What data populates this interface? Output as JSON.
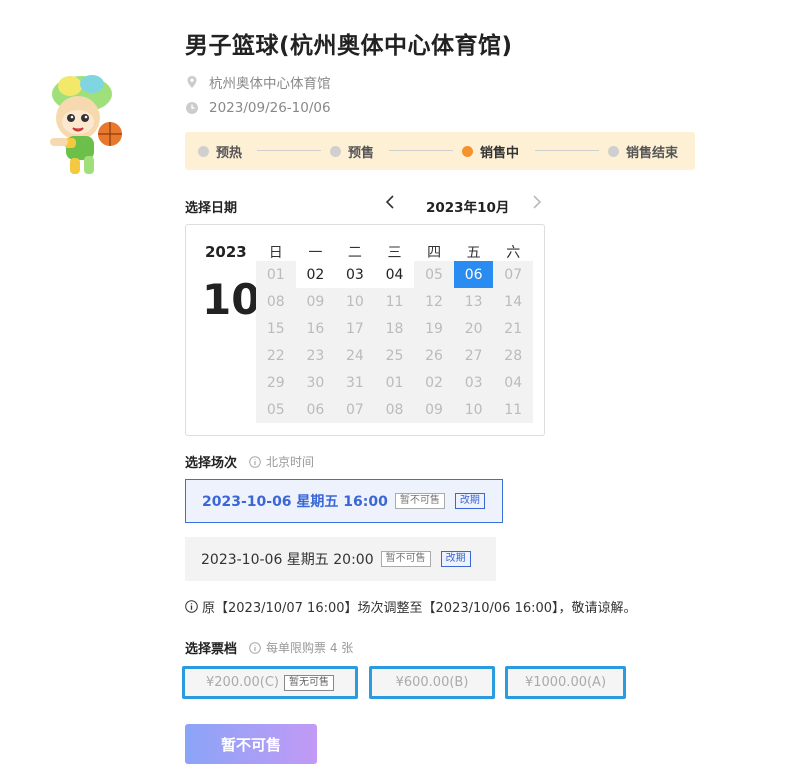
{
  "title": "男子篮球(杭州奥体中心体育馆)",
  "venue": "杭州奥体中心体育馆",
  "date_range": "2023/09/26-10/06",
  "progress": {
    "steps": [
      "预热",
      "预售",
      "销售中",
      "销售结束"
    ],
    "active_index": 2,
    "accent": "#f5922b"
  },
  "calendar_section": {
    "label": "选择日期",
    "month_label": "2023年10月",
    "year": "2023",
    "month": "10",
    "weekdays": [
      "日",
      "一",
      "二",
      "三",
      "四",
      "五",
      "六"
    ],
    "days": [
      {
        "d": "01",
        "state": "off"
      },
      {
        "d": "02",
        "state": "avail"
      },
      {
        "d": "03",
        "state": "avail"
      },
      {
        "d": "04",
        "state": "avail"
      },
      {
        "d": "05",
        "state": "off"
      },
      {
        "d": "06",
        "state": "selected"
      },
      {
        "d": "07",
        "state": "off"
      },
      {
        "d": "08",
        "state": "off"
      },
      {
        "d": "09",
        "state": "off"
      },
      {
        "d": "10",
        "state": "off"
      },
      {
        "d": "11",
        "state": "off"
      },
      {
        "d": "12",
        "state": "off"
      },
      {
        "d": "13",
        "state": "off"
      },
      {
        "d": "14",
        "state": "off"
      },
      {
        "d": "15",
        "state": "off"
      },
      {
        "d": "16",
        "state": "off"
      },
      {
        "d": "17",
        "state": "off"
      },
      {
        "d": "18",
        "state": "off"
      },
      {
        "d": "19",
        "state": "off"
      },
      {
        "d": "20",
        "state": "off"
      },
      {
        "d": "21",
        "state": "off"
      },
      {
        "d": "22",
        "state": "off"
      },
      {
        "d": "23",
        "state": "off"
      },
      {
        "d": "24",
        "state": "off"
      },
      {
        "d": "25",
        "state": "off"
      },
      {
        "d": "26",
        "state": "off"
      },
      {
        "d": "27",
        "state": "off"
      },
      {
        "d": "28",
        "state": "off"
      },
      {
        "d": "29",
        "state": "off"
      },
      {
        "d": "30",
        "state": "off"
      },
      {
        "d": "31",
        "state": "off"
      },
      {
        "d": "01",
        "state": "off"
      },
      {
        "d": "02",
        "state": "off"
      },
      {
        "d": "03",
        "state": "off"
      },
      {
        "d": "04",
        "state": "off"
      },
      {
        "d": "05",
        "state": "off"
      },
      {
        "d": "06",
        "state": "off"
      },
      {
        "d": "07",
        "state": "off"
      },
      {
        "d": "08",
        "state": "off"
      },
      {
        "d": "09",
        "state": "off"
      },
      {
        "d": "10",
        "state": "off"
      },
      {
        "d": "11",
        "state": "off"
      }
    ]
  },
  "session_section": {
    "label": "选择场次",
    "hint": "北京时间",
    "sessions": [
      {
        "text": "2023-10-06 星期五 16:00",
        "status": "暂不可售",
        "tag": "改期",
        "selected": true
      },
      {
        "text": "2023-10-06 星期五 20:00",
        "status": "暂不可售",
        "tag": "改期",
        "selected": false
      }
    ]
  },
  "notice": "原【2023/10/07 16:00】场次调整至【2023/10/06 16:00】，敬请谅解。",
  "ticket_section": {
    "label": "选择票档",
    "hint": "每单限购票 4 张",
    "tiers": [
      {
        "price": "¥200.00(C)",
        "status": "暂无可售"
      },
      {
        "price": "¥600.00(B)"
      },
      {
        "price": "¥1000.00(A)"
      }
    ]
  },
  "buy_button": "暂不可售"
}
